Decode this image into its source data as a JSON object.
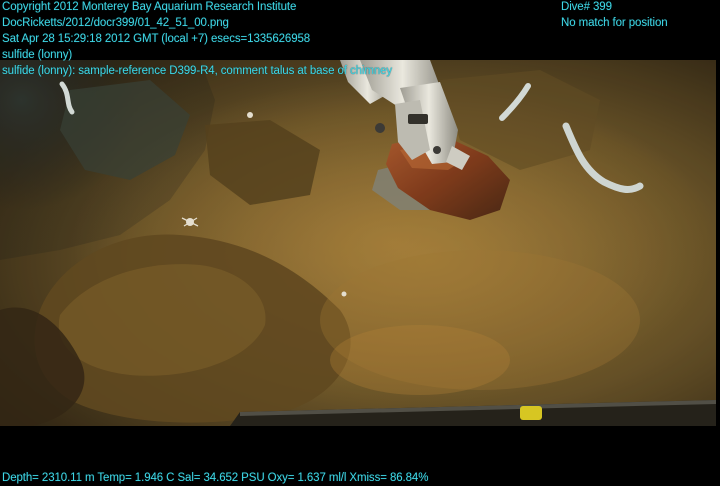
{
  "overlay": {
    "copyright": "Copyright 2012 Monterey Bay Aquarium Research Institute",
    "file_path": "DocRicketts/2012/docr399/01_42_51_00.png",
    "timestamp": "Sat Apr 28 15:29:18 2012 GMT (local +7)  esecs=1335626958",
    "annotation_1": "sulfide (lonny)",
    "annotation_2": "sulfide (lonny): sample-reference D399-R4, comment talus at base of chimney",
    "dive": "Dive# 399",
    "position_status": "No match for position",
    "telemetry": "Depth= 2310.11 m  Temp= 1.946 C  Sal= 34.652 PSU  Oxy= 1.637 ml/l  Xmiss= 86.84%"
  },
  "colors": {
    "overlay_text": "#3fd7e6",
    "seafloor": "#6b5424",
    "rock_sample": "#8a3f1c",
    "manipulator_arm": "#d9d9d2"
  }
}
